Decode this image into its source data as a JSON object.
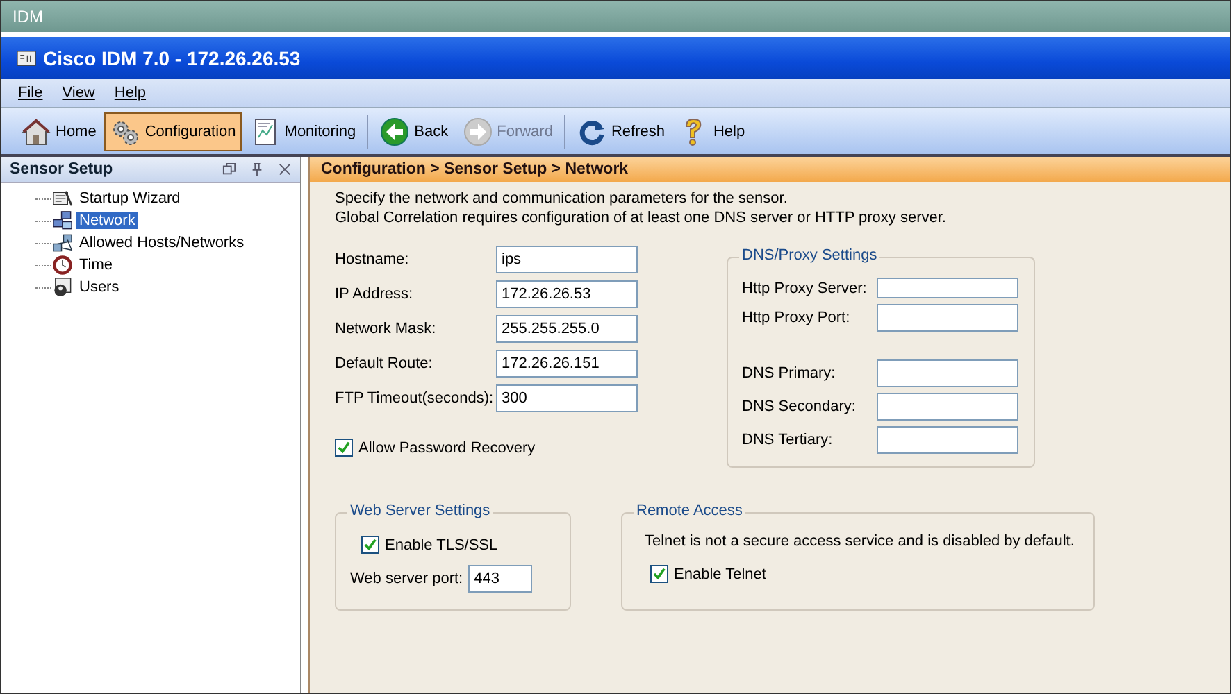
{
  "outer_window": {
    "title": "IDM"
  },
  "window": {
    "title": "Cisco IDM 7.0 - 172.26.26.53"
  },
  "menu": [
    "File",
    "View",
    "Help"
  ],
  "toolbar": [
    {
      "label": "Home",
      "kind": "home",
      "selected": false,
      "disabled": false
    },
    {
      "label": "Configuration",
      "kind": "gears",
      "selected": true,
      "disabled": false
    },
    {
      "label": "Monitoring",
      "kind": "chart",
      "selected": false,
      "disabled": false
    },
    {
      "label": "Back",
      "kind": "back",
      "selected": false,
      "disabled": false
    },
    {
      "label": "Forward",
      "kind": "forward",
      "selected": false,
      "disabled": true
    },
    {
      "label": "Refresh",
      "kind": "refresh",
      "selected": false,
      "disabled": false
    },
    {
      "label": "Help",
      "kind": "help",
      "selected": false,
      "disabled": false
    }
  ],
  "sidebar": {
    "title": "Sensor Setup",
    "items": [
      {
        "label": "Startup Wizard",
        "kind": "wizard",
        "selected": false
      },
      {
        "label": "Network",
        "kind": "network",
        "selected": true
      },
      {
        "label": "Allowed Hosts/Networks",
        "kind": "hosts",
        "selected": false
      },
      {
        "label": "Time",
        "kind": "clock",
        "selected": false
      },
      {
        "label": "Users",
        "kind": "users",
        "selected": false
      }
    ]
  },
  "content": {
    "breadcrumb": "Configuration > Sensor Setup > Network",
    "description": [
      "Specify the network and communication parameters for the sensor.",
      "Global Correlation requires configuration of at least one DNS server or HTTP proxy server."
    ],
    "fields": [
      {
        "label": "Hostname:",
        "value": "ips"
      },
      {
        "label": "IP Address:",
        "value": "172.26.26.53"
      },
      {
        "label": "Network Mask:",
        "value": "255.255.255.0"
      },
      {
        "label": "Default Route:",
        "value": "172.26.26.151"
      },
      {
        "label": "FTP Timeout(seconds):",
        "value": "300"
      }
    ],
    "allow_password_recovery": {
      "label": "Allow Password Recovery",
      "checked": true
    },
    "dns_proxy": {
      "title": "DNS/Proxy Settings",
      "fields": [
        {
          "label": "Http Proxy Server:",
          "kind": "short"
        },
        {
          "label": "Http Proxy Port:",
          "kind": "tall"
        },
        {
          "label": "DNS Primary:",
          "kind": "gap"
        },
        {
          "label": "DNS Secondary:",
          "kind": "tall"
        },
        {
          "label": "DNS Tertiary:",
          "kind": "tall"
        }
      ]
    },
    "web_server": {
      "title": "Web Server Settings",
      "tls": {
        "label": "Enable TLS/SSL",
        "checked": true
      },
      "port_label": "Web server port:",
      "port": "443"
    },
    "remote_access": {
      "title": "Remote Access",
      "note": "Telnet is not a secure access service and is disabled by default.",
      "telnet": {
        "label": "Enable Telnet",
        "checked": true
      }
    }
  }
}
